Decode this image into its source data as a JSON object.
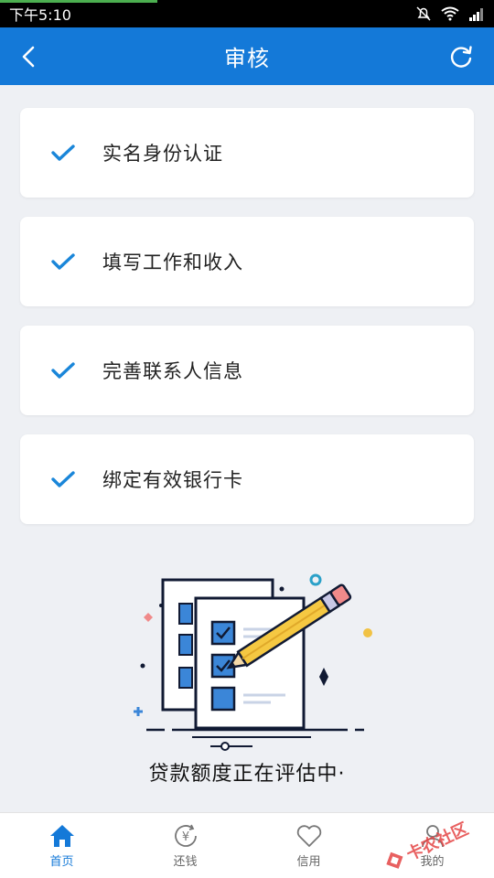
{
  "status_bar": {
    "time": "下午5:10"
  },
  "header": {
    "title": "审核"
  },
  "steps": [
    {
      "label": "实名身份认证"
    },
    {
      "label": "填写工作和收入"
    },
    {
      "label": "完善联系人信息"
    },
    {
      "label": "绑定有效银行卡"
    }
  ],
  "evaluation": {
    "text": "贷款额度正在评估中·"
  },
  "tabs": [
    {
      "label": "首页",
      "icon": "home-icon",
      "active": true
    },
    {
      "label": "还钱",
      "icon": "repay-icon",
      "active": false
    },
    {
      "label": "信用",
      "icon": "heart-icon",
      "active": false
    },
    {
      "label": "我的",
      "icon": "profile-icon",
      "active": false
    }
  ],
  "watermark": {
    "text": "卡农社区"
  },
  "colors": {
    "primary": "#1479d8",
    "check": "#1a86d9"
  }
}
